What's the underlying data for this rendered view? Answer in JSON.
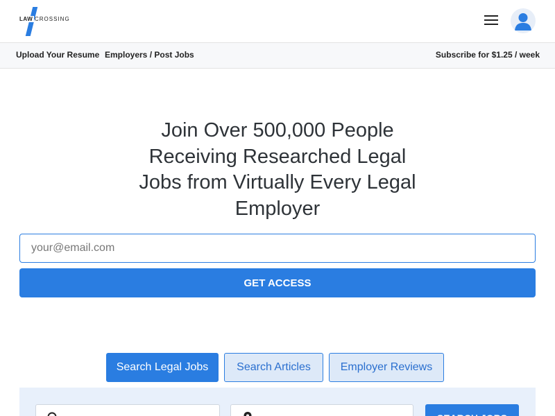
{
  "brand": {
    "logo_word1": "LAW",
    "logo_word2": "CROSSING",
    "accent_color": "#2a7de1"
  },
  "header": {
    "menu_icon": "hamburger-icon",
    "avatar_icon": "user-avatar-icon"
  },
  "subnav": {
    "upload_label": "Upload Your Resume",
    "employers_label": "Employers / Post Jobs",
    "subscribe_label": "Subscribe for $1.25 / week"
  },
  "hero": {
    "title": "Join Over 500,000 People Receiving Researched Legal Jobs from Virtually Every Legal Employer",
    "email_placeholder": "your@email.com",
    "email_value": "",
    "cta_label": "GET ACCESS"
  },
  "tabs": [
    {
      "label": "Search Legal Jobs",
      "active": true
    },
    {
      "label": "Search Articles",
      "active": false
    },
    {
      "label": "Employer Reviews",
      "active": false
    }
  ],
  "search": {
    "keyword_icon": "search-icon",
    "location_icon": "location-pin-icon",
    "button_label": "SEARCH JOBS"
  }
}
